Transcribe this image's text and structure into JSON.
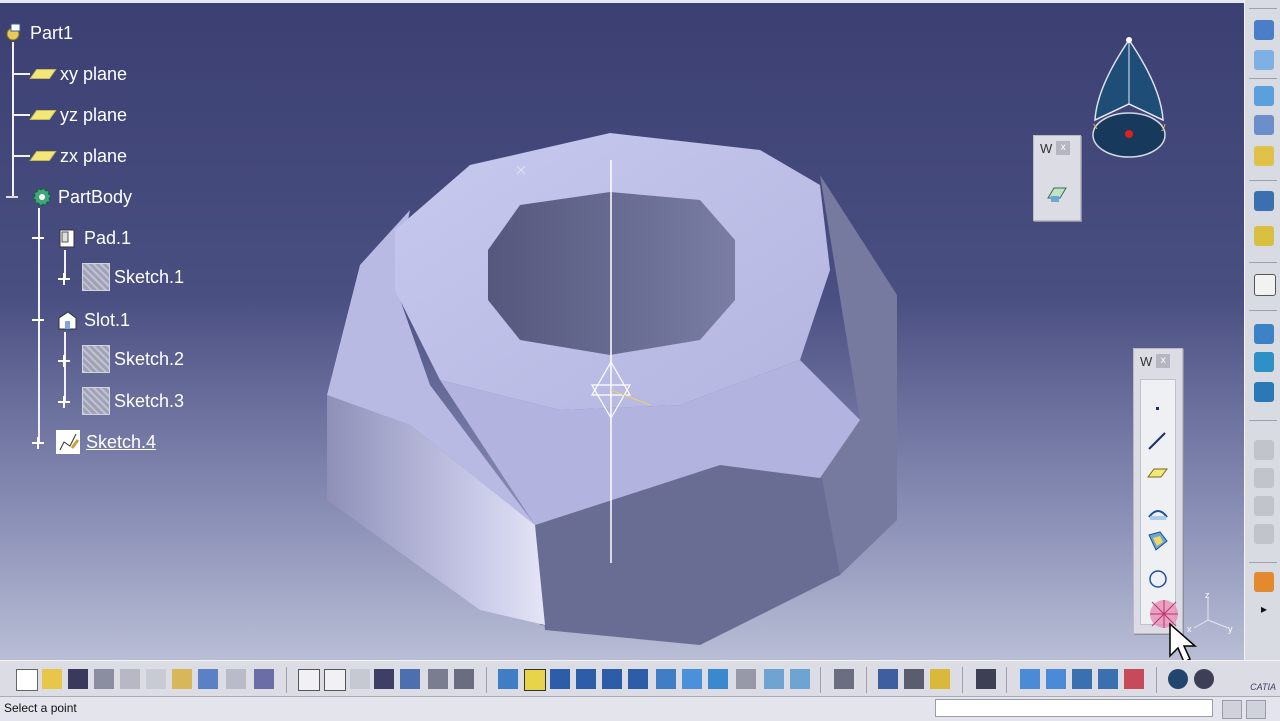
{
  "tree": {
    "root": "Part1",
    "planes": [
      "xy plane",
      "yz plane",
      "zx plane"
    ],
    "body": "PartBody",
    "features": [
      {
        "label": "Pad.1",
        "children": [
          "Sketch.1"
        ]
      },
      {
        "label": "Slot.1",
        "children": [
          "Sketch.2",
          "Sketch.3"
        ]
      }
    ],
    "sketch4": "Sketch.4"
  },
  "toolbar_w1": {
    "title": "W",
    "close": "x"
  },
  "toolbar_w2": {
    "title": "W",
    "close": "x"
  },
  "axis": {
    "x": "x",
    "y": "y",
    "z": "z"
  },
  "compass": {
    "x": "x",
    "y": "y"
  },
  "status": {
    "prompt": "Select a point",
    "command_value": ""
  },
  "brand": "CATIA",
  "colors": {
    "background_top": "#3b3f72",
    "background_bottom": "#b9bed6",
    "part": "#c3c4ec",
    "tree_text": "#ffffff"
  }
}
